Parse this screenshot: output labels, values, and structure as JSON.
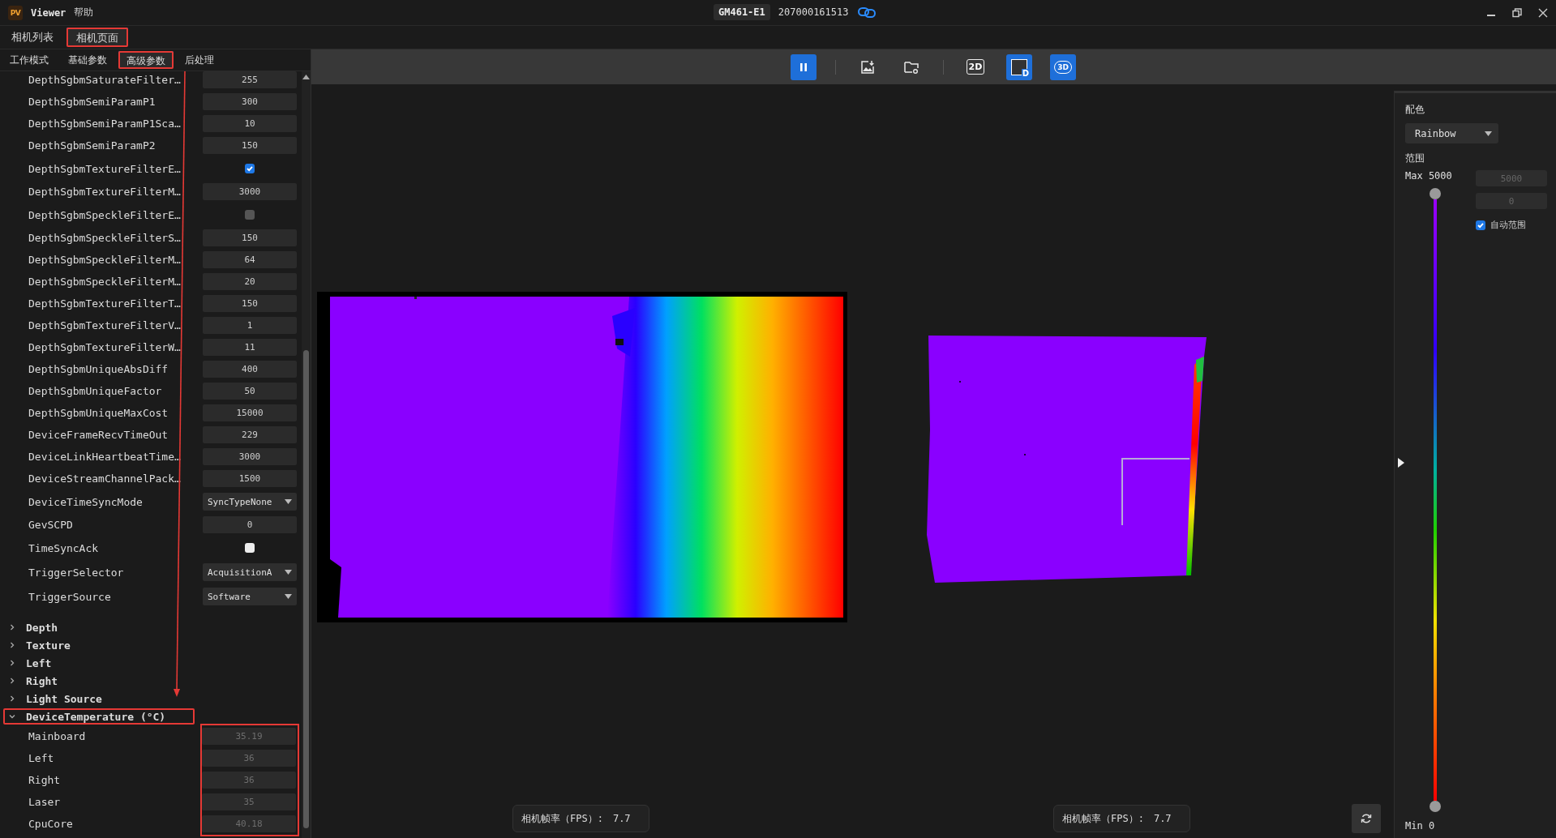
{
  "window": {
    "logo": "PV",
    "app_name": "Viewer",
    "menu": [
      "帮助"
    ],
    "device_model": "GM461-E1",
    "serial": "207000161513",
    "connected": true
  },
  "tabs": [
    {
      "label": "相机列表",
      "selected": false,
      "highlighted": false
    },
    {
      "label": "相机页面",
      "selected": true,
      "highlighted": true
    }
  ],
  "subtabs": [
    {
      "label": "工作模式",
      "selected": false,
      "highlighted": false
    },
    {
      "label": "基础参数",
      "selected": false,
      "highlighted": false
    },
    {
      "label": "高级参数",
      "selected": true,
      "highlighted": true
    },
    {
      "label": "后处理",
      "selected": false,
      "highlighted": false
    }
  ],
  "parameters": [
    {
      "kind": "value",
      "name": "DepthSgbmSaturateFilter…",
      "value": "255"
    },
    {
      "kind": "value",
      "name": "DepthSgbmSemiParamP1",
      "value": "300"
    },
    {
      "kind": "value",
      "name": "DepthSgbmSemiParamP1Sca…",
      "value": "10"
    },
    {
      "kind": "value",
      "name": "DepthSgbmSemiParamP2",
      "value": "150"
    },
    {
      "kind": "checkbox",
      "name": "DepthSgbmTextureFilterE…",
      "checked": true,
      "disabled": false
    },
    {
      "kind": "value",
      "name": "DepthSgbmTextureFilterM…",
      "value": "3000"
    },
    {
      "kind": "checkbox",
      "name": "DepthSgbmSpeckleFilterE…",
      "checked": false,
      "disabled": true
    },
    {
      "kind": "value",
      "name": "DepthSgbmSpeckleFilterS…",
      "value": "150"
    },
    {
      "kind": "value",
      "name": "DepthSgbmSpeckleFilterM…",
      "value": "64"
    },
    {
      "kind": "value",
      "name": "DepthSgbmSpeckleFilterM…",
      "value": "20"
    },
    {
      "kind": "value",
      "name": "DepthSgbmTextureFilterT…",
      "value": "150"
    },
    {
      "kind": "value",
      "name": "DepthSgbmTextureFilterV…",
      "value": "1"
    },
    {
      "kind": "value",
      "name": "DepthSgbmTextureFilterW…",
      "value": "11"
    },
    {
      "kind": "value",
      "name": "DepthSgbmUniqueAbsDiff",
      "value": "400"
    },
    {
      "kind": "value",
      "name": "DepthSgbmUniqueFactor",
      "value": "50"
    },
    {
      "kind": "value",
      "name": "DepthSgbmUniqueMaxCost",
      "value": "15000"
    },
    {
      "kind": "value",
      "name": "DeviceFrameRecvTimeOut",
      "value": "229"
    },
    {
      "kind": "value",
      "name": "DeviceLinkHeartbeatTime…",
      "value": "3000"
    },
    {
      "kind": "value",
      "name": "DeviceStreamChannelPack…",
      "value": "1500"
    },
    {
      "kind": "select",
      "name": "DeviceTimeSyncMode",
      "value": "SyncTypeNone"
    },
    {
      "kind": "value",
      "name": "GevSCPD",
      "value": "0"
    },
    {
      "kind": "checkbox",
      "name": "TimeSyncAck",
      "checked": false,
      "disabled": false
    },
    {
      "kind": "select",
      "name": "TriggerSelector",
      "value": "AcquisitionA"
    },
    {
      "kind": "select",
      "name": "TriggerSource",
      "value": "Software"
    }
  ],
  "groups": [
    {
      "name": "Depth",
      "expanded": false,
      "highlighted": false
    },
    {
      "name": "Texture",
      "expanded": false,
      "highlighted": false
    },
    {
      "name": "Left",
      "expanded": false,
      "highlighted": false
    },
    {
      "name": "Right",
      "expanded": false,
      "highlighted": false
    },
    {
      "name": "Light Source",
      "expanded": false,
      "highlighted": false
    },
    {
      "name": "DeviceTemperature (°C)",
      "expanded": true,
      "highlighted": true,
      "values_highlighted": true,
      "children": [
        {
          "name": "Mainboard",
          "value": "35.19",
          "disabled": true
        },
        {
          "name": "Left",
          "value": "36",
          "disabled": true
        },
        {
          "name": "Right",
          "value": "36",
          "disabled": true
        },
        {
          "name": "Laser",
          "value": "35",
          "disabled": true
        },
        {
          "name": "CpuCore",
          "value": "40.18",
          "disabled": true
        }
      ]
    }
  ],
  "annotation_arrow": true,
  "toolbar": [
    {
      "kind": "pause",
      "active": true
    },
    {
      "kind": "separator"
    },
    {
      "kind": "save-image",
      "active": false
    },
    {
      "kind": "folder",
      "active": false
    },
    {
      "kind": "separator"
    },
    {
      "kind": "badge",
      "label": "2D",
      "active": false
    },
    {
      "kind": "depth",
      "label": "D",
      "active": true
    },
    {
      "kind": "cloud",
      "label": "3D",
      "active": true
    }
  ],
  "fps": [
    {
      "label": "相机帧率（FPS）:",
      "value": "7.7"
    },
    {
      "label": "相机帧率（FPS）:",
      "value": "7.7"
    }
  ],
  "color_panel": {
    "colormap_label": "配色",
    "colormap": "Rainbow",
    "range_label": "范围",
    "max_label": "Max 5000",
    "min_label": "Min 0",
    "max_value": "5000",
    "min_value": "0",
    "inputs_disabled": true,
    "auto_range": {
      "label": "自动范围",
      "checked": true
    },
    "upper": {
      "level": 1
    },
    "lower": {
      "level": 0
    }
  }
}
